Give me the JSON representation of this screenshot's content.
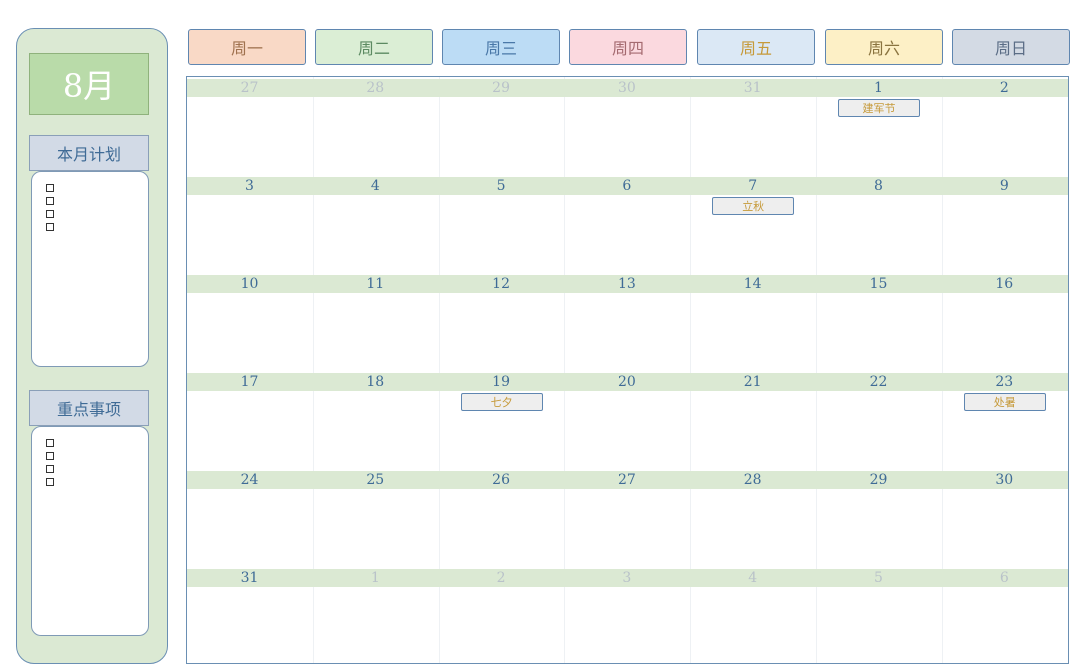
{
  "sidebar": {
    "month": "8月",
    "plan_title": "本月计划",
    "key_title": "重点事项",
    "plan_items": [
      "□",
      "□",
      "□",
      "□"
    ],
    "key_items": [
      "□",
      "□",
      "□",
      "□"
    ]
  },
  "weekdays": [
    {
      "label": "周一",
      "bg": "#f9d9c6",
      "color": "#a0724f"
    },
    {
      "label": "周二",
      "bg": "#dbeed5",
      "color": "#5c8a62"
    },
    {
      "label": "周三",
      "bg": "#bcdcf5",
      "color": "#4a78a8"
    },
    {
      "label": "周四",
      "bg": "#fbd9df",
      "color": "#a46a70"
    },
    {
      "label": "周五",
      "bg": "#dbe8f5",
      "color": "#c69a3a"
    },
    {
      "label": "周六",
      "bg": "#fdf0c6",
      "color": "#8a7440"
    },
    {
      "label": "周日",
      "bg": "#d3dae4",
      "color": "#5b6d86"
    }
  ],
  "weeks": [
    [
      {
        "d": "27",
        "m": true
      },
      {
        "d": "28",
        "m": true
      },
      {
        "d": "29",
        "m": true
      },
      {
        "d": "30",
        "m": true
      },
      {
        "d": "31",
        "m": true
      },
      {
        "d": "1",
        "m": false
      },
      {
        "d": "2",
        "m": false
      }
    ],
    [
      {
        "d": "3",
        "m": false
      },
      {
        "d": "4",
        "m": false
      },
      {
        "d": "5",
        "m": false
      },
      {
        "d": "6",
        "m": false
      },
      {
        "d": "7",
        "m": false
      },
      {
        "d": "8",
        "m": false
      },
      {
        "d": "9",
        "m": false
      }
    ],
    [
      {
        "d": "10",
        "m": false
      },
      {
        "d": "11",
        "m": false
      },
      {
        "d": "12",
        "m": false
      },
      {
        "d": "13",
        "m": false
      },
      {
        "d": "14",
        "m": false
      },
      {
        "d": "15",
        "m": false
      },
      {
        "d": "16",
        "m": false
      }
    ],
    [
      {
        "d": "17",
        "m": false
      },
      {
        "d": "18",
        "m": false
      },
      {
        "d": "19",
        "m": false
      },
      {
        "d": "20",
        "m": false
      },
      {
        "d": "21",
        "m": false
      },
      {
        "d": "22",
        "m": false
      },
      {
        "d": "23",
        "m": false
      }
    ],
    [
      {
        "d": "24",
        "m": false
      },
      {
        "d": "25",
        "m": false
      },
      {
        "d": "26",
        "m": false
      },
      {
        "d": "27",
        "m": false
      },
      {
        "d": "28",
        "m": false
      },
      {
        "d": "29",
        "m": false
      },
      {
        "d": "30",
        "m": false
      }
    ],
    [
      {
        "d": "31",
        "m": false
      },
      {
        "d": "1",
        "m": true
      },
      {
        "d": "2",
        "m": true
      },
      {
        "d": "3",
        "m": true
      },
      {
        "d": "4",
        "m": true
      },
      {
        "d": "5",
        "m": true
      },
      {
        "d": "6",
        "m": true
      }
    ]
  ],
  "events": [
    {
      "week": 0,
      "day": 5,
      "label": "建军节"
    },
    {
      "week": 1,
      "day": 4,
      "label": "立秋"
    },
    {
      "week": 3,
      "day": 2,
      "label": "七夕"
    },
    {
      "week": 3,
      "day": 6,
      "label": "处暑"
    }
  ]
}
